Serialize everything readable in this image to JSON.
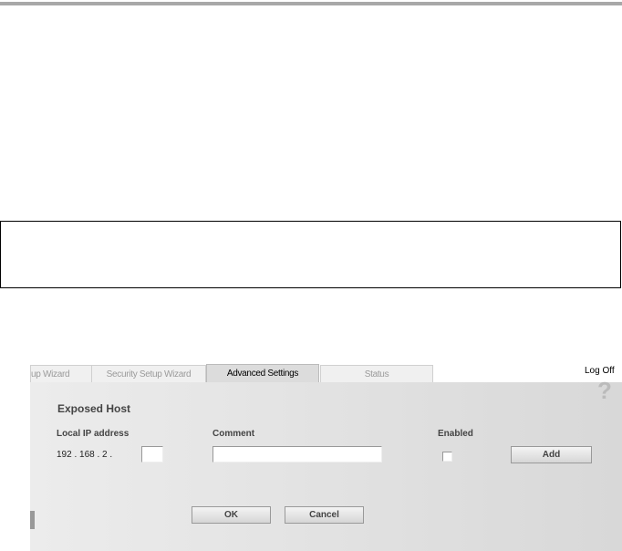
{
  "tabs": [
    {
      "label": "up Wizard"
    },
    {
      "label": "Security Setup Wizard"
    },
    {
      "label": "Advanced Settings"
    },
    {
      "label": "Status"
    }
  ],
  "log_off": "Log Off",
  "panel": {
    "title": "Exposed Host",
    "help": "?",
    "col_ip": "Local IP address",
    "col_comment": "Comment",
    "col_enabled": "Enabled",
    "ip_prefix": "192 . 168 .  2  .",
    "ip_last": "",
    "comment": "",
    "enabled": false,
    "add": "Add",
    "ok": "OK",
    "cancel": "Cancel"
  }
}
